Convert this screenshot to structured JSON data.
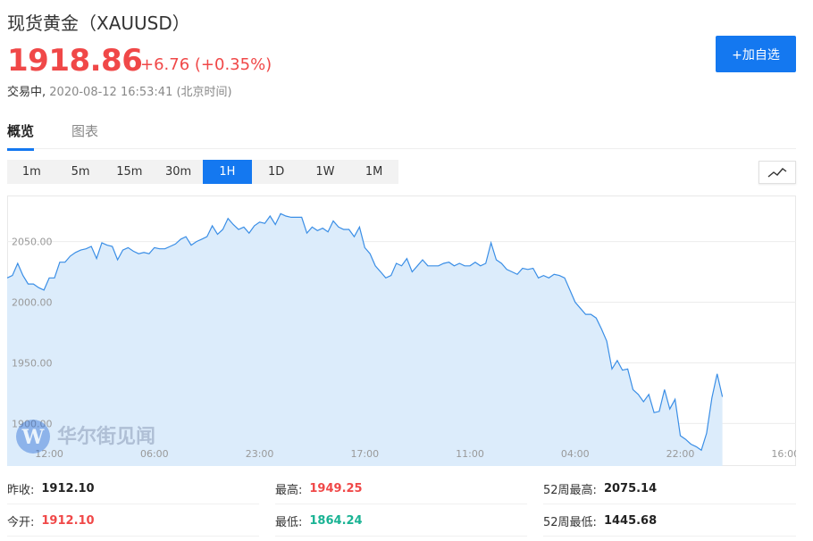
{
  "header": {
    "title": "现货黄金（XAUUSD）",
    "price": "1918.86",
    "change": "+6.76 (+0.35%)",
    "status_label": "交易中,",
    "timestamp": "2020-08-12 16:53:41 (北京时间)",
    "add_button": "+加自选"
  },
  "tabs": [
    {
      "label": "概览",
      "active": true
    },
    {
      "label": "图表",
      "active": false
    }
  ],
  "periods": [
    "1m",
    "5m",
    "15m",
    "30m",
    "1H",
    "1D",
    "1W",
    "1M"
  ],
  "active_period": "1H",
  "chart_type_icon": "line-chart-icon",
  "watermark": "华尔街见闻",
  "colors": {
    "up": "#f04848",
    "down": "#1ab394",
    "accent": "#1478f0",
    "line": "#3a8ee6",
    "fill": "#dcecfb"
  },
  "stats": [
    {
      "label": "昨收:",
      "value": "1912.10",
      "color": "dark"
    },
    {
      "label": "最高:",
      "value": "1949.25",
      "color": "red"
    },
    {
      "label": "52周最高:",
      "value": "2075.14",
      "color": "dark"
    },
    {
      "label": "今开:",
      "value": "1912.10",
      "color": "red"
    },
    {
      "label": "最低:",
      "value": "1864.24",
      "color": "green"
    },
    {
      "label": "52周最低:",
      "value": "1445.68",
      "color": "dark"
    }
  ],
  "chart_data": {
    "type": "area",
    "x_tick_labels": [
      "12:00",
      "06:00",
      "23:00",
      "17:00",
      "11:00",
      "04:00",
      "22:00",
      "16:00"
    ],
    "y_tick_labels": [
      "2050.00",
      "2000.00",
      "1950.00",
      "1900.00"
    ],
    "ylim": [
      1865,
      2085
    ],
    "grid": true,
    "x_index_range": [
      0,
      150
    ],
    "x_tick_indices": [
      8,
      28,
      48,
      68,
      88,
      108,
      128,
      148
    ],
    "series": [
      {
        "values": [
          2020,
          2022,
          2032,
          2022,
          2015,
          2015,
          2012,
          2010,
          2020,
          2020,
          2033,
          2033,
          2038,
          2041,
          2043,
          2044,
          2046,
          2036,
          2049,
          2047,
          2046,
          2035,
          2043,
          2045,
          2042,
          2040,
          2041,
          2040,
          2045,
          2044,
          2044,
          2046,
          2048,
          2052,
          2054,
          2047,
          2050,
          2052,
          2054,
          2063,
          2056,
          2060,
          2069,
          2064,
          2060,
          2062,
          2057,
          2063,
          2066,
          2065,
          2071,
          2064,
          2073,
          2071,
          2070,
          2070,
          2070,
          2057,
          2062,
          2059,
          2061,
          2058,
          2067,
          2062,
          2060,
          2060,
          2054,
          2062,
          2045,
          2040,
          2030,
          2025,
          2020,
          2022,
          2032,
          2030,
          2036,
          2025,
          2030,
          2035,
          2030,
          2030,
          2030,
          2032,
          2033,
          2030,
          2032,
          2030,
          2030,
          2033,
          2030,
          2032,
          2049,
          2035,
          2032,
          2027,
          2025,
          2023,
          2028,
          2027,
          2028,
          2020,
          2022,
          2020,
          2023,
          2022,
          2020,
          2010,
          2000,
          1995,
          1990,
          1990,
          1987,
          1978,
          1968,
          1945,
          1952,
          1944,
          1945,
          1928,
          1924,
          1918,
          1924,
          1909,
          1910,
          1928,
          1912,
          1920,
          1890,
          1887,
          1883,
          1881,
          1878,
          1892,
          1921,
          1941,
          1922
        ]
      }
    ]
  }
}
